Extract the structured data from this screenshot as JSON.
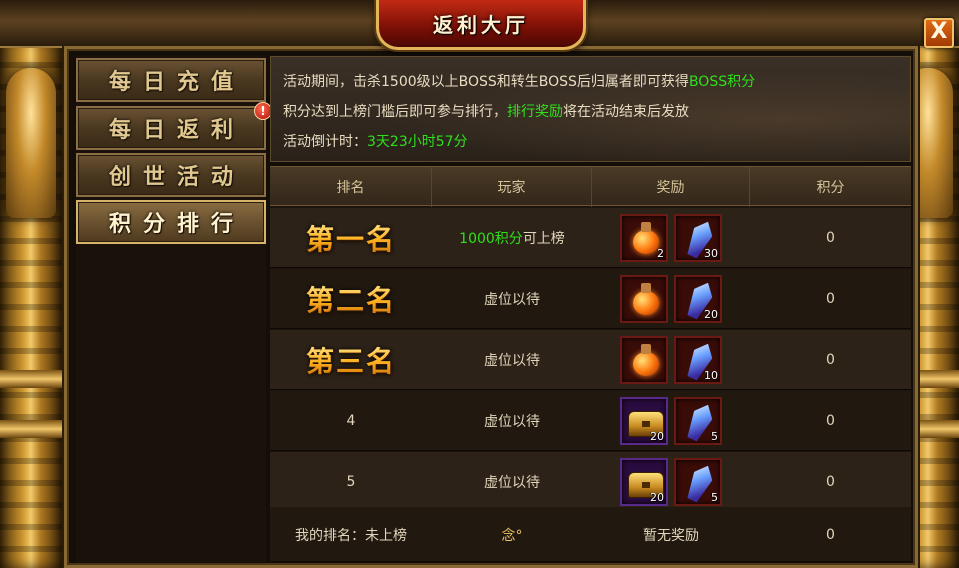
{
  "window": {
    "title": "返利大厅",
    "close_label": "X"
  },
  "sidebar": {
    "items": [
      {
        "label": "每日充值",
        "active": false,
        "alert": false
      },
      {
        "label": "每日返利",
        "active": false,
        "alert": true
      },
      {
        "label": "创世活动",
        "active": false,
        "alert": false
      },
      {
        "label": "积分排行",
        "active": true,
        "alert": false
      }
    ],
    "alert_symbol": "!"
  },
  "info": {
    "line1_prefix": "活动期间，击杀1500级以上BOSS和转生BOSS后归属者即可获得",
    "line1_highlight": "BOSS积分",
    "line2_prefix": "积分达到上榜门槛后即可参与排行，",
    "line2_highlight": "排行奖励",
    "line2_suffix": "将在活动结束后发放",
    "line3_prefix": "活动倒计时：",
    "line3_highlight": "3天23小时57分"
  },
  "table": {
    "headers": [
      "排名",
      "玩家",
      "奖励",
      "积分"
    ],
    "rows": [
      {
        "rank": "第一名",
        "rank_style": "big",
        "player_highlight": "1000积分",
        "player": "可上榜",
        "rewards": [
          {
            "icon": "potion-icon",
            "count": "2"
          },
          {
            "icon": "crystal-icon",
            "count": "30"
          }
        ],
        "score": "0"
      },
      {
        "rank": "第二名",
        "rank_style": "big",
        "player_highlight": "",
        "player": "虚位以待",
        "rewards": [
          {
            "icon": "potion-icon",
            "count": ""
          },
          {
            "icon": "crystal-icon",
            "count": "20"
          }
        ],
        "score": "0"
      },
      {
        "rank": "第三名",
        "rank_style": "big",
        "player_highlight": "",
        "player": "虚位以待",
        "rewards": [
          {
            "icon": "potion-icon",
            "count": ""
          },
          {
            "icon": "crystal-icon",
            "count": "10"
          }
        ],
        "score": "0"
      },
      {
        "rank": "4",
        "rank_style": "plain",
        "player_highlight": "",
        "player": "虚位以待",
        "rewards": [
          {
            "icon": "chest-icon",
            "count": "20"
          },
          {
            "icon": "crystal-icon",
            "count": "5"
          }
        ],
        "score": "0"
      },
      {
        "rank": "5",
        "rank_style": "plain",
        "player_highlight": "",
        "player": "虚位以待",
        "rewards": [
          {
            "icon": "chest-icon",
            "count": "20"
          },
          {
            "icon": "crystal-icon",
            "count": "5"
          }
        ],
        "score": "0"
      }
    ],
    "mine": {
      "rank_label": "我的排名：未上榜",
      "player": "念°",
      "reward": "暂无奖励",
      "score": "0"
    }
  },
  "colors": {
    "highlight_green": "#2fe01c",
    "title_red": "#c22a14",
    "gold": "#e4b65a"
  }
}
